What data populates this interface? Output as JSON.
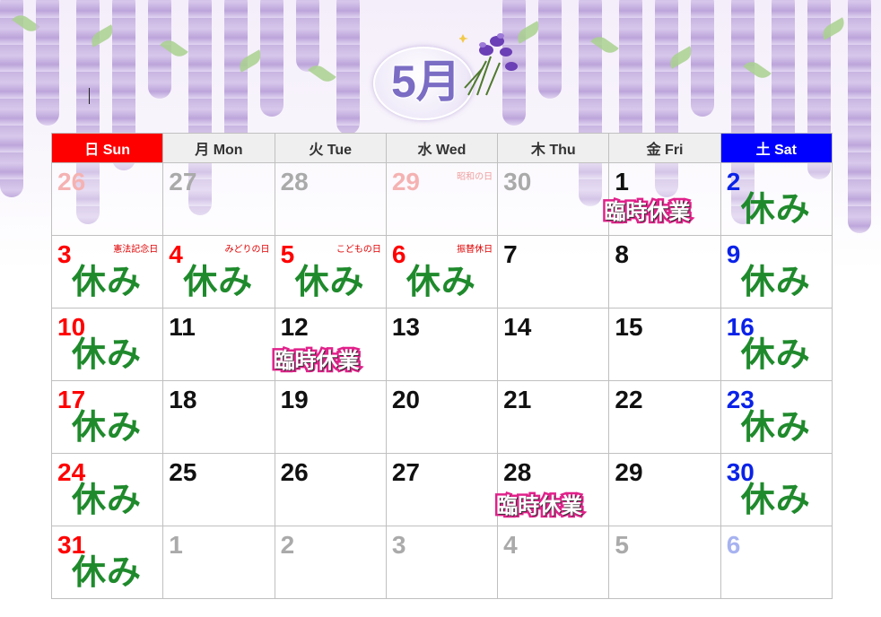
{
  "month_title": "5月",
  "weekdays": [
    "日 Sun",
    "月 Mon",
    "火 Tue",
    "水 Wed",
    "木 Thu",
    "金 Fri",
    "土 Sat"
  ],
  "closed_label": "休み",
  "temporary_closure_label": "臨時休業",
  "weeks": [
    [
      {
        "day": "26",
        "style": "pink"
      },
      {
        "day": "27",
        "style": "grey"
      },
      {
        "day": "28",
        "style": "grey"
      },
      {
        "day": "29",
        "style": "pink",
        "holiday": "昭和の日"
      },
      {
        "day": "30",
        "style": "grey"
      },
      {
        "day": "1",
        "style": "black",
        "temp_closed": true
      },
      {
        "day": "2",
        "style": "blue",
        "closed": true
      }
    ],
    [
      {
        "day": "3",
        "style": "red",
        "holiday": "憲法記念日",
        "closed": true
      },
      {
        "day": "4",
        "style": "red",
        "holiday": "みどりの日",
        "closed": true
      },
      {
        "day": "5",
        "style": "red",
        "holiday": "こどもの日",
        "closed": true
      },
      {
        "day": "6",
        "style": "red",
        "holiday": "振替休日",
        "closed": true
      },
      {
        "day": "7",
        "style": "black"
      },
      {
        "day": "8",
        "style": "black"
      },
      {
        "day": "9",
        "style": "blue",
        "closed": true
      }
    ],
    [
      {
        "day": "10",
        "style": "red",
        "closed": true
      },
      {
        "day": "11",
        "style": "black"
      },
      {
        "day": "12",
        "style": "black",
        "temp_closed": true
      },
      {
        "day": "13",
        "style": "black"
      },
      {
        "day": "14",
        "style": "black"
      },
      {
        "day": "15",
        "style": "black"
      },
      {
        "day": "16",
        "style": "blue",
        "closed": true
      }
    ],
    [
      {
        "day": "17",
        "style": "red",
        "closed": true
      },
      {
        "day": "18",
        "style": "black"
      },
      {
        "day": "19",
        "style": "black"
      },
      {
        "day": "20",
        "style": "black"
      },
      {
        "day": "21",
        "style": "black"
      },
      {
        "day": "22",
        "style": "black"
      },
      {
        "day": "23",
        "style": "blue",
        "closed": true
      }
    ],
    [
      {
        "day": "24",
        "style": "red",
        "closed": true
      },
      {
        "day": "25",
        "style": "black"
      },
      {
        "day": "26",
        "style": "black"
      },
      {
        "day": "27",
        "style": "black"
      },
      {
        "day": "28",
        "style": "black",
        "temp_closed": true
      },
      {
        "day": "29",
        "style": "black"
      },
      {
        "day": "30",
        "style": "blue",
        "closed": true
      }
    ],
    [
      {
        "day": "31",
        "style": "red",
        "closed": true
      },
      {
        "day": "1",
        "style": "grey"
      },
      {
        "day": "2",
        "style": "grey"
      },
      {
        "day": "3",
        "style": "grey"
      },
      {
        "day": "4",
        "style": "grey"
      },
      {
        "day": "5",
        "style": "grey"
      },
      {
        "day": "6",
        "style": "lightblue"
      }
    ]
  ],
  "colors": {
    "sunday_header": "#ff0000",
    "saturday_header": "#0000ff",
    "closed_text": "#1f8a2c",
    "temporary_closure_outline": "#e0218a",
    "accent_title": "#7b6cc4"
  },
  "icons": [
    "wisteria-decoration",
    "iris-flower-icon"
  ]
}
